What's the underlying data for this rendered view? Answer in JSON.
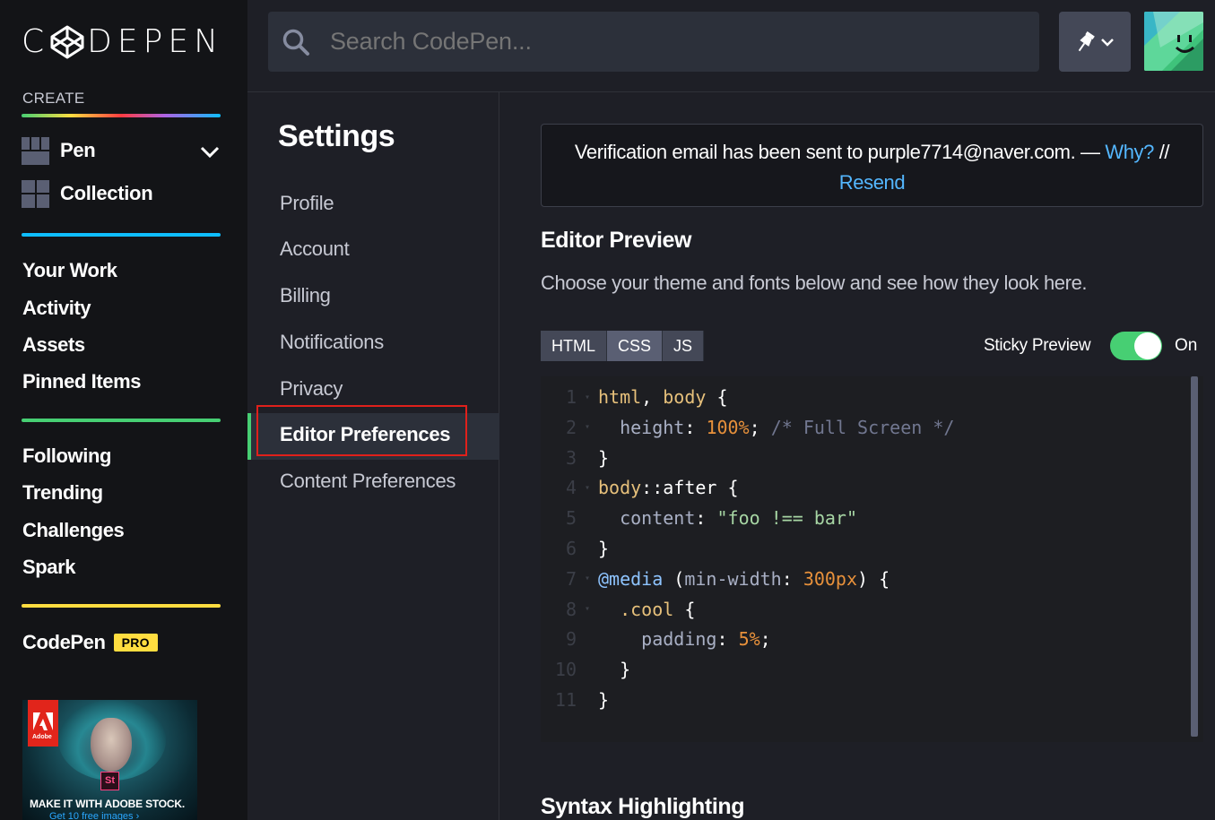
{
  "sidebar": {
    "logo_text_left": "C",
    "logo_text_right": "DEPEN",
    "create_label": "CREATE",
    "create_items": [
      "Pen",
      "Collection"
    ],
    "nav_group_1": [
      "Your Work",
      "Activity",
      "Assets",
      "Pinned Items"
    ],
    "nav_group_2": [
      "Following",
      "Trending",
      "Challenges",
      "Spark"
    ],
    "codepen_label": "CodePen",
    "pro_badge": "PRO",
    "bar_colors": [
      "#47cf73",
      "#ffdd40",
      "#ff3c41",
      "#ae63e4",
      "#0ebeff"
    ],
    "ad": {
      "brand": "Adobe",
      "product_badge": "St",
      "headline": "MAKE IT WITH ADOBE STOCK.",
      "subline": "Get 10 free images ›"
    }
  },
  "header": {
    "search_placeholder": "Search CodePen...",
    "pin_icon": "pin-icon",
    "avatar_icon": "smiley-avatar"
  },
  "settings_nav": {
    "title": "Settings",
    "items": [
      "Profile",
      "Account",
      "Billing",
      "Notifications",
      "Privacy",
      "Editor Preferences",
      "Content Preferences"
    ],
    "active": "Editor Preferences"
  },
  "main": {
    "verify": {
      "message": "Verification email has been sent to purple7714@naver.com. —",
      "why": "Why?",
      "sep": "//",
      "resend": "Resend"
    },
    "editor_preview": {
      "heading": "Editor Preview",
      "description": "Choose your theme and fonts below and see how they look here.",
      "tabs": [
        "HTML",
        "CSS",
        "JS"
      ],
      "active_tab": "CSS",
      "sticky_label": "Sticky Preview",
      "sticky_state": "On"
    },
    "code_lines": [
      {
        "n": "1",
        "fold": true,
        "tokens": [
          [
            "c-sel",
            "html"
          ],
          [
            "code",
            ", "
          ],
          [
            "c-sel",
            "body"
          ],
          [
            "code",
            " {"
          ]
        ]
      },
      {
        "n": "2",
        "fold": true,
        "tokens": [
          [
            "code",
            "  "
          ],
          [
            "c-key",
            "height"
          ],
          [
            "code",
            ": "
          ],
          [
            "c-num",
            "100%"
          ],
          [
            "code",
            "; "
          ],
          [
            "c-com",
            "/* Full Screen */"
          ]
        ]
      },
      {
        "n": "3",
        "fold": false,
        "tokens": [
          [
            "code",
            "}"
          ]
        ]
      },
      {
        "n": "4",
        "fold": true,
        "tokens": [
          [
            "c-sel",
            "body"
          ],
          [
            "code",
            "::after {"
          ]
        ]
      },
      {
        "n": "5",
        "fold": false,
        "tokens": [
          [
            "code",
            "  "
          ],
          [
            "c-key",
            "content"
          ],
          [
            "code",
            ": "
          ],
          [
            "c-str",
            "\"foo !== bar\""
          ]
        ]
      },
      {
        "n": "6",
        "fold": false,
        "tokens": [
          [
            "code",
            "}"
          ]
        ]
      },
      {
        "n": "7",
        "fold": true,
        "tokens": [
          [
            "c-at",
            "@media"
          ],
          [
            "code",
            " ("
          ],
          [
            "c-kw",
            "min-width"
          ],
          [
            "code",
            ": "
          ],
          [
            "c-num",
            "300px"
          ],
          [
            "code",
            ") {"
          ]
        ]
      },
      {
        "n": "8",
        "fold": true,
        "tokens": [
          [
            "code",
            "  "
          ],
          [
            "c-sel",
            ".cool"
          ],
          [
            "code",
            " {"
          ]
        ]
      },
      {
        "n": "9",
        "fold": false,
        "tokens": [
          [
            "code",
            "    "
          ],
          [
            "c-key",
            "padding"
          ],
          [
            "code",
            ": "
          ],
          [
            "c-num",
            "5%"
          ],
          [
            "code",
            ";"
          ]
        ]
      },
      {
        "n": "10",
        "fold": false,
        "tokens": [
          [
            "code",
            "  }"
          ]
        ]
      },
      {
        "n": "11",
        "fold": false,
        "tokens": [
          [
            "code",
            "}"
          ]
        ]
      }
    ],
    "syntax_heading": "Syntax Highlighting"
  }
}
